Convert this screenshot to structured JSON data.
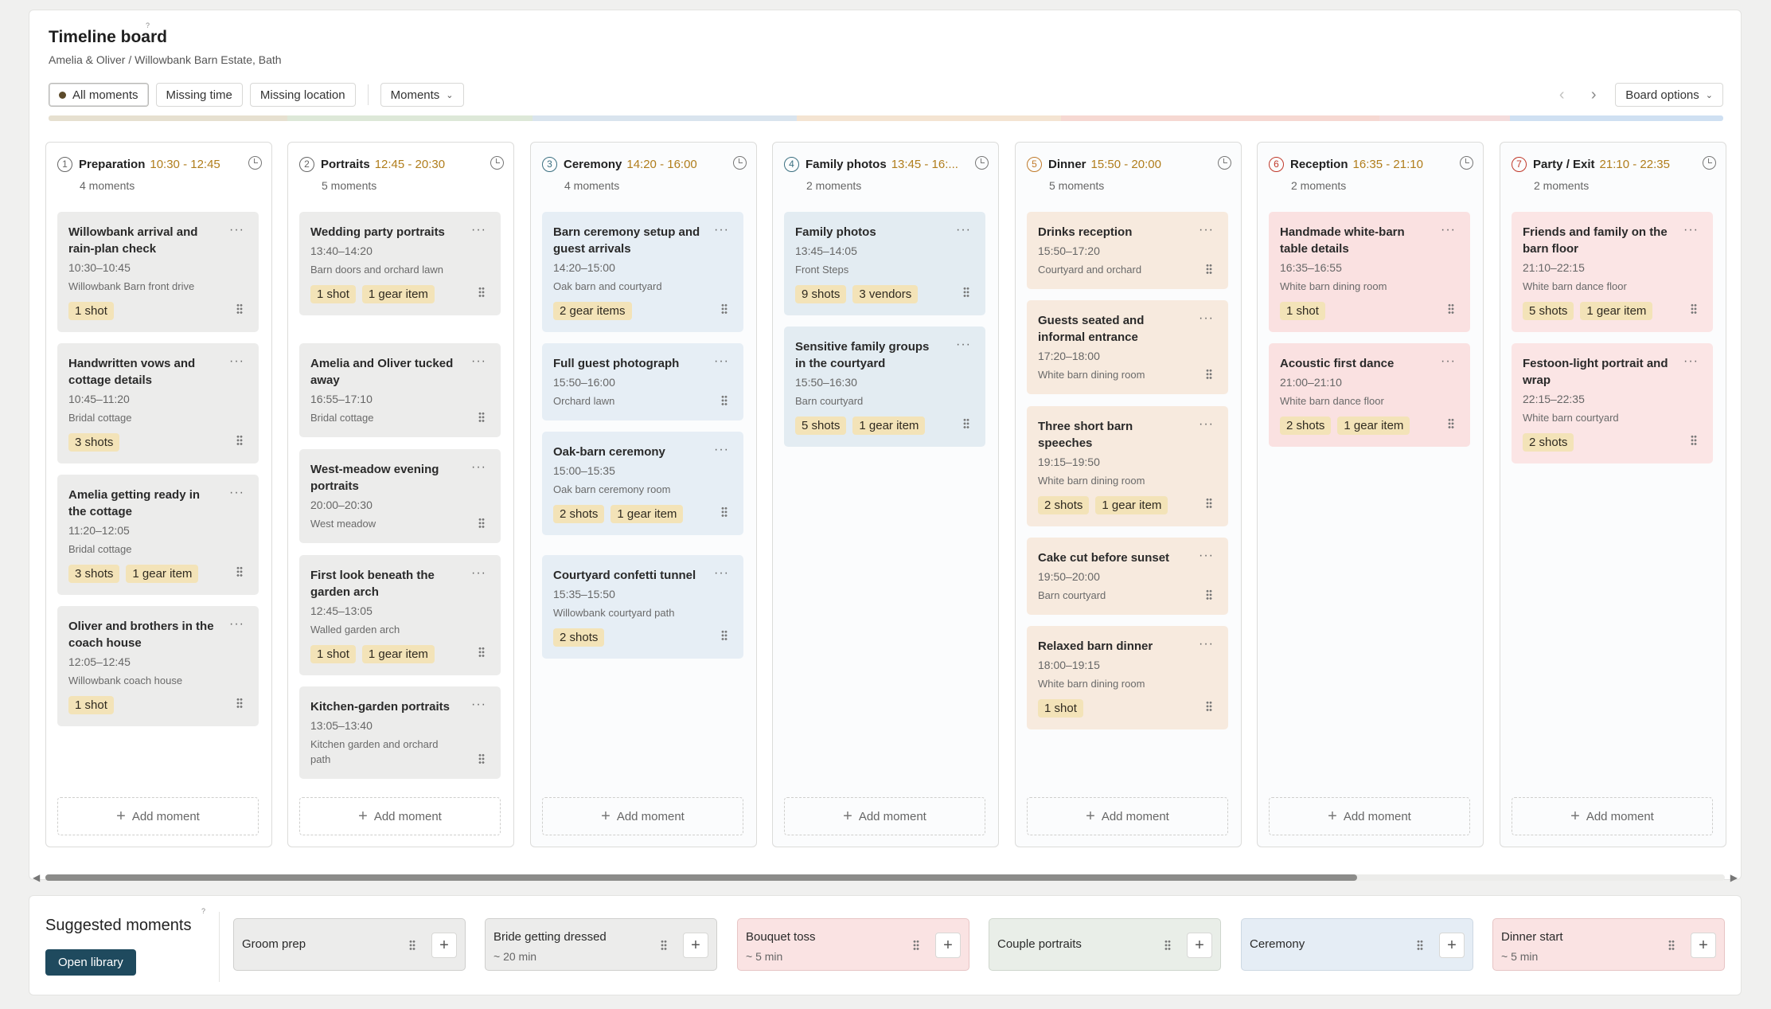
{
  "header": {
    "title": "Timeline board",
    "subtitle": "Amelia & Oliver / Willowbank Barn Estate, Bath",
    "help": "?"
  },
  "filters": {
    "all": "All moments",
    "missing_time": "Missing time",
    "missing_location": "Missing location",
    "moments_dropdown": "Moments",
    "board_options": "Board options"
  },
  "nav": {
    "prev": "‹",
    "next": "›"
  },
  "add_label": "Add moment",
  "band_colors": [
    "#e6e0d0",
    "#dde8d8",
    "#d9e4ee",
    "#f4e4d2",
    "#f6d8d2",
    "#f4dcdc",
    "#cfe0f2"
  ],
  "columns": [
    {
      "num": "1",
      "name": "Preparation",
      "time": "10:30 - 12:45",
      "count": "4 moments",
      "accent": "#b07d1b",
      "numcolor": "#666",
      "cards": [
        {
          "title": "Willowbank arrival and rain-plan check",
          "time": "10:30–10:45",
          "loc": "Willowbank Barn front drive",
          "tags": [
            "1 shot"
          ]
        },
        {
          "title": "Handwritten vows and cottage details",
          "time": "10:45–11:20",
          "loc": "Bridal cottage",
          "tags": [
            "3 shots"
          ]
        },
        {
          "title": "Amelia getting ready in the cottage",
          "time": "11:20–12:05",
          "loc": "Bridal cottage",
          "tags": [
            "3 shots",
            "1 gear item"
          ]
        },
        {
          "title": "Oliver and brothers in the coach house",
          "time": "12:05–12:45",
          "loc": "Willowbank coach house",
          "tags": [
            "1 shot"
          ]
        }
      ]
    },
    {
      "num": "2",
      "name": "Portraits",
      "time": "12:45 - 20:30",
      "count": "5 moments",
      "accent": "#b07d1b",
      "numcolor": "#666",
      "cards": [
        {
          "title": "Wedding party portraits",
          "time": "13:40–14:20",
          "loc": "Barn doors and orchard lawn",
          "tags": [
            "1 shot",
            "1 gear item"
          ]
        },
        {
          "title": "Amelia and Oliver tucked away",
          "time": "16:55–17:10",
          "loc": "Bridal cottage",
          "tags": []
        },
        {
          "title": "West-meadow evening portraits",
          "time": "20:00–20:30",
          "loc": "West meadow",
          "tags": []
        },
        {
          "title": "First look beneath the garden arch",
          "time": "12:45–13:05",
          "loc": "Walled garden arch",
          "tags": [
            "1 shot",
            "1 gear item"
          ]
        },
        {
          "title": "Kitchen-garden portraits",
          "time": "13:05–13:40",
          "loc": "Kitchen garden and orchard path",
          "tags": []
        }
      ]
    },
    {
      "num": "3",
      "name": "Ceremony",
      "time": "14:20 - 16:00",
      "count": "4 moments",
      "accent": "#b07d1b",
      "numcolor": "#3a6f80",
      "cards": [
        {
          "title": "Barn ceremony setup and guest arrivals",
          "time": "14:20–15:00",
          "loc": "Oak barn and courtyard",
          "tags": [
            "2 gear items"
          ]
        },
        {
          "title": "Full guest photograph",
          "time": "15:50–16:00",
          "loc": "Orchard lawn",
          "tags": []
        },
        {
          "title": "Oak-barn ceremony",
          "time": "15:00–15:35",
          "loc": "Oak barn ceremony room",
          "tags": [
            "2 shots",
            "1 gear item"
          ]
        },
        {
          "title": "Courtyard confetti tunnel",
          "time": "15:35–15:50",
          "loc": "Willowbank courtyard path",
          "tags": [
            "2 shots"
          ]
        }
      ]
    },
    {
      "num": "4",
      "name": "Family photos",
      "time": "13:45 - 16:...",
      "count": "2 moments",
      "accent": "#b07d1b",
      "numcolor": "#3a6f80",
      "cards": [
        {
          "title": "Family photos",
          "time": "13:45–14:05",
          "loc": "Front Steps",
          "tags": [
            "9 shots",
            "3 vendors"
          ]
        },
        {
          "title": "Sensitive family groups in the courtyard",
          "time": "15:50–16:30",
          "loc": "Barn courtyard",
          "tags": [
            "5 shots",
            "1 gear item"
          ]
        }
      ]
    },
    {
      "num": "5",
      "name": "Dinner",
      "time": "15:50 - 20:00",
      "count": "5 moments",
      "accent": "#b07d1b",
      "numcolor": "#c07a2a",
      "cards": [
        {
          "title": "Drinks reception",
          "time": "15:50–17:20",
          "loc": "Courtyard and orchard",
          "tags": []
        },
        {
          "title": "Guests seated and informal entrance",
          "time": "17:20–18:00",
          "loc": "White barn dining room",
          "tags": []
        },
        {
          "title": "Three short barn speeches",
          "time": "19:15–19:50",
          "loc": "White barn dining room",
          "tags": [
            "2 shots",
            "1 gear item"
          ]
        },
        {
          "title": "Cake cut before sunset",
          "time": "19:50–20:00",
          "loc": "Barn courtyard",
          "tags": []
        },
        {
          "title": "Relaxed barn dinner",
          "time": "18:00–19:15",
          "loc": "White barn dining room",
          "tags": [
            "1 shot"
          ]
        }
      ]
    },
    {
      "num": "6",
      "name": "Reception",
      "time": "16:35 - 21:10",
      "count": "2 moments",
      "accent": "#b07d1b",
      "numcolor": "#c0392b",
      "cards": [
        {
          "title": "Handmade white-barn table details",
          "time": "16:35–16:55",
          "loc": "White barn dining room",
          "tags": [
            "1 shot"
          ]
        },
        {
          "title": "Acoustic first dance",
          "time": "21:00–21:10",
          "loc": "White barn dance floor",
          "tags": [
            "2 shots",
            "1 gear item"
          ]
        }
      ]
    },
    {
      "num": "7",
      "name": "Party / Exit",
      "time": "21:10 - 22:35",
      "count": "2 moments",
      "accent": "#b07d1b",
      "numcolor": "#c0392b",
      "cards": [
        {
          "title": "Friends and family on the barn floor",
          "time": "21:10–22:15",
          "loc": "White barn dance floor",
          "tags": [
            "5 shots",
            "1 gear item"
          ]
        },
        {
          "title": "Festoon-light portrait and wrap",
          "time": "22:15–22:35",
          "loc": "White barn courtyard",
          "tags": [
            "2 shots"
          ]
        }
      ]
    }
  ],
  "suggested": {
    "title": "Suggested moments",
    "help": "?",
    "open_library": "Open library",
    "items": [
      {
        "name": "Groom prep",
        "duration": "",
        "bg": "#ececeb",
        "border": "#cfcfcd"
      },
      {
        "name": "Bride getting dressed",
        "duration": "~ 20 min",
        "bg": "#ececeb",
        "border": "#cfcfcd"
      },
      {
        "name": "Bouquet toss",
        "duration": "~ 5 min",
        "bg": "#fae3e3",
        "border": "#e7c5c5"
      },
      {
        "name": "Couple portraits",
        "duration": "",
        "bg": "#e9eee8",
        "border": "#cfd6cd"
      },
      {
        "name": "Ceremony",
        "duration": "",
        "bg": "#e5edf5",
        "border": "#cdd8e3"
      },
      {
        "name": "Dinner start",
        "duration": "~ 5 min",
        "bg": "#fae3e3",
        "border": "#e7c5c5"
      }
    ]
  }
}
